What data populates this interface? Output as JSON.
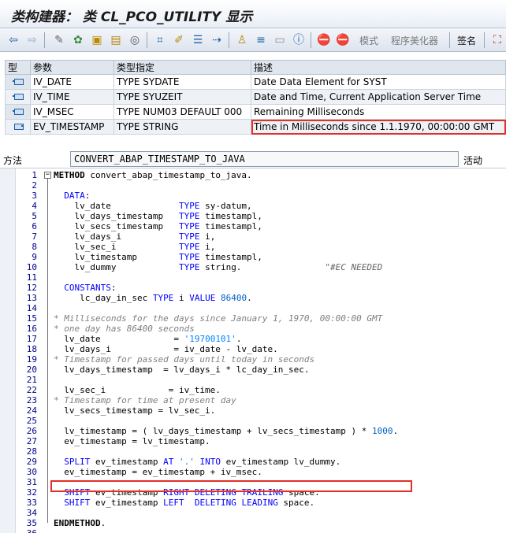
{
  "title_bar": {
    "title": "类构建器： 类 CL_PCO_UTILITY 显示"
  },
  "toolbar": {
    "mode_label": "模式",
    "pretty_printer_label": "程序美化器",
    "signature_label": "签名"
  },
  "params": {
    "headers": {
      "type": "型",
      "param": "参数",
      "typing": "类型指定",
      "desc": "描述"
    },
    "rows": [
      {
        "name": "IV_DATE",
        "typing": "TYPE SYDATE",
        "desc": "Date Data Element for SYST"
      },
      {
        "name": "IV_TIME",
        "typing": "TYPE SYUZEIT",
        "desc": "Date and Time, Current Application Server Time"
      },
      {
        "name": "IV_MSEC",
        "typing": "TYPE NUM03  DEFAULT 000",
        "desc": "Remaining Milliseconds"
      },
      {
        "name": "EV_TIMESTAMP",
        "typing": "TYPE STRING",
        "desc": "Time in Milliseconds since 1.1.1970, 00:00:00 GMT"
      }
    ]
  },
  "method": {
    "label": "方法",
    "name": "CONVERT_ABAP_TIMESTAMP_TO_JAVA",
    "state": "活动"
  },
  "code_lines": [
    {
      "no": "1",
      "html": "<span class='bold'>METHOD</span> convert_abap_timestamp_to_java."
    },
    {
      "no": "2",
      "html": ""
    },
    {
      "no": "3",
      "html": "  <span class='kw'>DATA</span>:"
    },
    {
      "no": "4",
      "html": "    lv_date             <span class='kw'>TYPE</span> sy-datum,"
    },
    {
      "no": "5",
      "html": "    lv_days_timestamp   <span class='kw'>TYPE</span> timestampl,"
    },
    {
      "no": "6",
      "html": "    lv_secs_timestamp   <span class='kw'>TYPE</span> timestampl,"
    },
    {
      "no": "7",
      "html": "    lv_days_i           <span class='kw'>TYPE</span> i,"
    },
    {
      "no": "8",
      "html": "    lv_sec_i            <span class='kw'>TYPE</span> i,"
    },
    {
      "no": "9",
      "html": "    lv_timestamp        <span class='kw'>TYPE</span> timestampl,"
    },
    {
      "no": "10",
      "html": "    lv_dummy            <span class='kw'>TYPE</span> string.                <span class='pragma'>\"#EC NEEDED</span>"
    },
    {
      "no": "11",
      "html": ""
    },
    {
      "no": "12",
      "html": "  <span class='kw'>CONSTANTS</span>:"
    },
    {
      "no": "13",
      "html": "     lc_day_in_sec <span class='kw'>TYPE</span> i <span class='kw'>VALUE</span> <span class='num'>86400</span>."
    },
    {
      "no": "14",
      "html": ""
    },
    {
      "no": "15",
      "html": "<span class='cmt'>* Milliseconds for the days since January 1, 1970, 00:00:00 GMT</span>"
    },
    {
      "no": "16",
      "html": "<span class='cmt'>* one day has 86400 seconds</span>"
    },
    {
      "no": "17",
      "html": "  lv_date              = <span class='str'>'19700101'</span>."
    },
    {
      "no": "18",
      "html": "  lv_days_i            = iv_date - lv_date."
    },
    {
      "no": "19",
      "html": "<span class='cmt'>* Timestamp for passed days until today in seconds</span>"
    },
    {
      "no": "20",
      "html": "  lv_days_timestamp  = lv_days_i * lc_day_in_sec."
    },
    {
      "no": "21",
      "html": ""
    },
    {
      "no": "22",
      "html": "  lv_sec_i            = iv_time."
    },
    {
      "no": "23",
      "html": "<span class='cmt'>* Timestamp for time at present day</span>"
    },
    {
      "no": "24",
      "html": "  lv_secs_timestamp = lv_sec_i."
    },
    {
      "no": "25",
      "html": ""
    },
    {
      "no": "26",
      "html": "  lv_timestamp = ( lv_days_timestamp + lv_secs_timestamp ) * <span class='num'>1000</span>."
    },
    {
      "no": "27",
      "html": "  ev_timestamp = lv_timestamp."
    },
    {
      "no": "28",
      "html": ""
    },
    {
      "no": "29",
      "html": "  <span class='kw'>SPLIT</span> ev_timestamp <span class='kw'>AT</span> <span class='str'>'.'</span> <span class='kw'>INTO</span> ev_timestamp lv_dummy."
    },
    {
      "no": "30",
      "html": "  ev_timestamp = ev_timestamp + iv_msec."
    },
    {
      "no": "31",
      "html": ""
    },
    {
      "no": "32",
      "html": "  <span class='kw'>SHIFT</span> ev_timestamp <span class='kw'>RIGHT</span> <span class='kw'>DELETING</span> <span class='kw'>TRAILING</span> space."
    },
    {
      "no": "33",
      "html": "  <span class='kw'>SHIFT</span> ev_timestamp <span class='kw'>LEFT</span>  <span class='kw'>DELETING</span> <span class='kw'>LEADING</span> space."
    },
    {
      "no": "34",
      "html": ""
    },
    {
      "no": "35",
      "html": "<span class='bold'>ENDMETHOD</span>."
    },
    {
      "no": "36",
      "html": ""
    }
  ]
}
